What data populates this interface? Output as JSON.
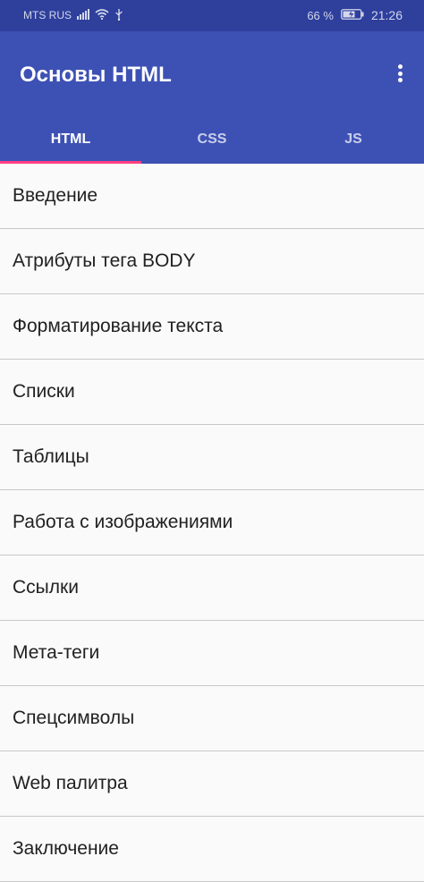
{
  "status_bar": {
    "carrier": "MTS RUS",
    "icons": [
      "signal-icon",
      "wifi-icon",
      "usb-icon"
    ],
    "battery_percent": "66 %",
    "time": "21:26"
  },
  "app_bar": {
    "title": "Основы HTML",
    "menu_icon": "more-vert-icon",
    "background": "#3d51b5",
    "status_background": "#2e3f9c",
    "accent": "#ff4081"
  },
  "tabs": [
    {
      "label": "HTML",
      "active": true
    },
    {
      "label": "CSS",
      "active": false
    },
    {
      "label": "JS",
      "active": false
    }
  ],
  "lessons": [
    {
      "label": "Введение"
    },
    {
      "label": "Атрибуты тега BODY"
    },
    {
      "label": "Форматирование текста"
    },
    {
      "label": "Списки"
    },
    {
      "label": "Таблицы"
    },
    {
      "label": "Работа с изображениями"
    },
    {
      "label": "Ссылки"
    },
    {
      "label": "Мета-теги"
    },
    {
      "label": "Спецсимволы"
    },
    {
      "label": "Web палитра"
    },
    {
      "label": "Заключение"
    }
  ]
}
